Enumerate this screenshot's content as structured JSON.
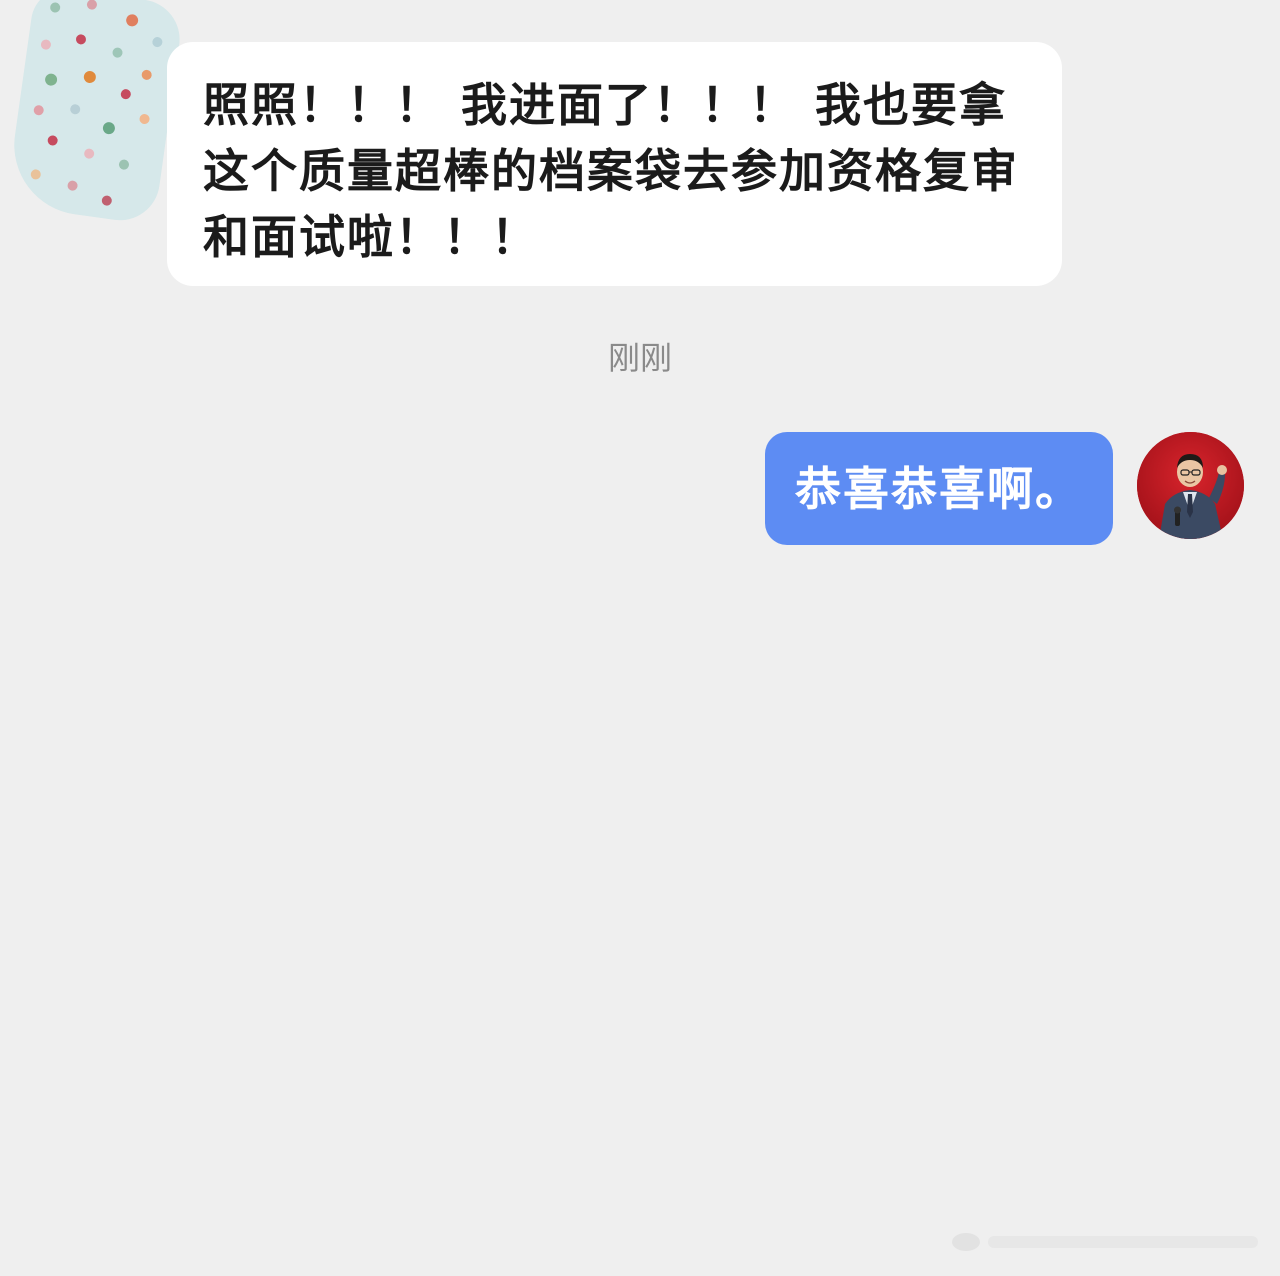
{
  "conversation": {
    "incoming": {
      "avatar_icon": "polka-dot-avatar-icon",
      "text": "照照！！！ 我进面了！！！ 我也要拿这个质量超棒的档案袋去参加资格复审和面试啦！！！"
    },
    "timestamp": "刚刚",
    "outgoing": {
      "text": "恭喜恭喜啊。",
      "avatar_icon": "user-photo-avatar-icon"
    }
  },
  "colors": {
    "background": "#efefef",
    "incoming_bubble": "#ffffff",
    "outgoing_bubble": "#5d8cf3",
    "timestamp_text": "#8a8a8a",
    "message_text": "#1b1b1b"
  }
}
